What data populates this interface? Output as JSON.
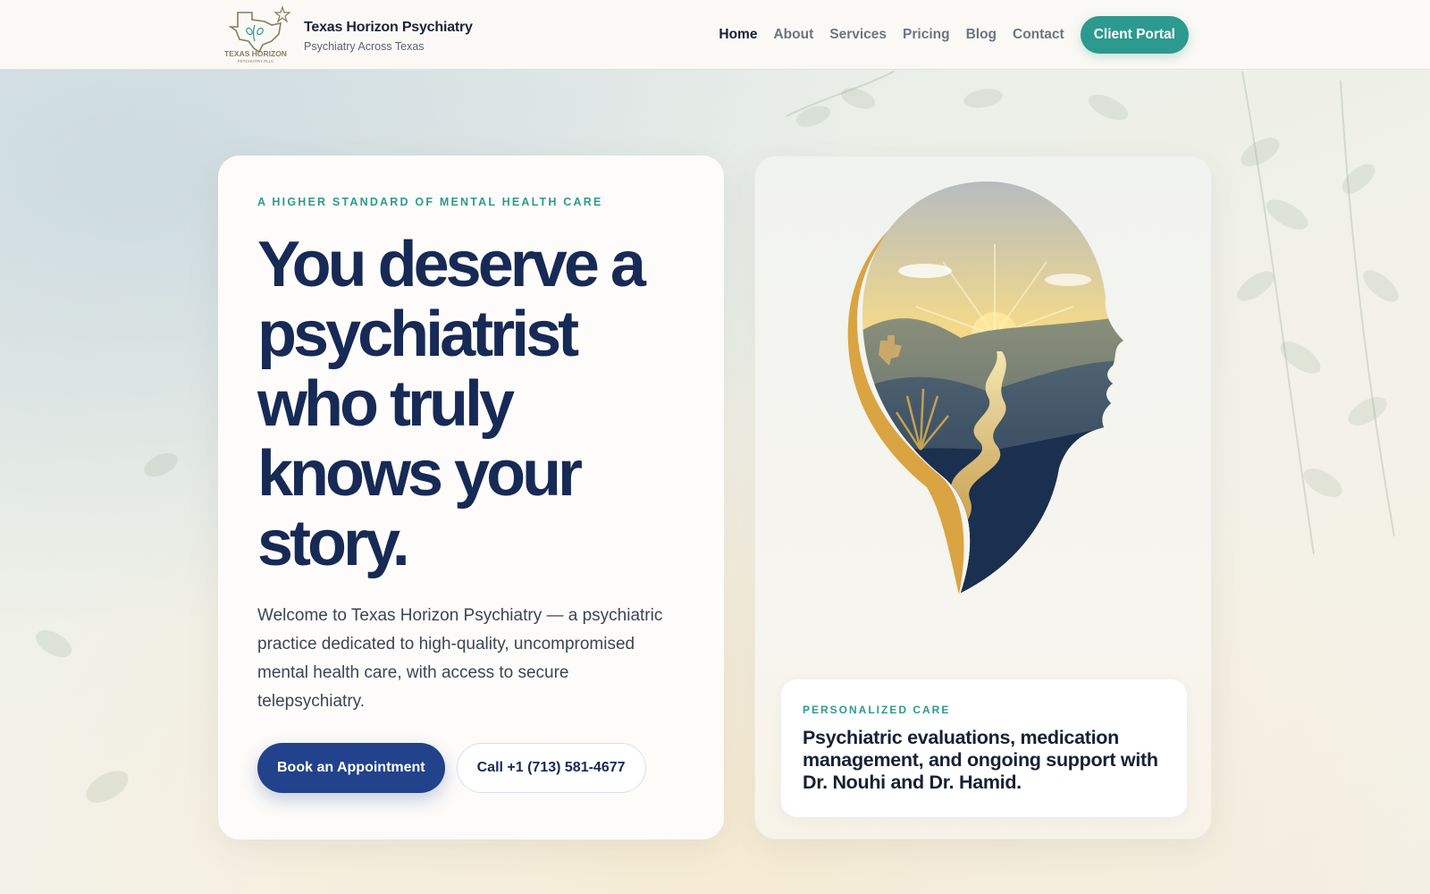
{
  "header": {
    "brand_name": "Texas Horizon Psychiatry",
    "brand_tagline": "Psychiatry Across Texas",
    "logo_text": "TEXAS HORIZON",
    "logo_subtext": "PSYCHIATRY PLLC",
    "nav": [
      {
        "label": "Home",
        "active": true
      },
      {
        "label": "About",
        "active": false
      },
      {
        "label": "Services",
        "active": false
      },
      {
        "label": "Pricing",
        "active": false
      },
      {
        "label": "Blog",
        "active": false
      },
      {
        "label": "Contact",
        "active": false
      }
    ],
    "portal_label": "Client Portal"
  },
  "hero": {
    "eyebrow": "A HIGHER STANDARD OF MENTAL HEALTH CARE",
    "headline": "You deserve a psychiatrist who truly knows your story.",
    "intro": "Welcome to Texas Horizon Psychiatry — a psychiatric practice dedicated to high-quality, uncompromised mental health care, with access to secure telepsychiatry.",
    "primary_cta": "Book an Appointment",
    "secondary_cta": "Call +1 (713) 581-4677"
  },
  "feature": {
    "eyebrow": "PERSONALIZED CARE",
    "text": "Psychiatric evaluations, medication management, and ongoing support with Dr. Nouhi and Dr. Hamid."
  },
  "colors": {
    "accent_teal": "#2c9a8e",
    "primary_navy": "#22428b",
    "headline_navy": "#172a56",
    "gold": "#d9a441"
  },
  "icons": {
    "logo": "texas-star-logo-icon",
    "art": "head-silhouette-sunrise-landscape"
  }
}
